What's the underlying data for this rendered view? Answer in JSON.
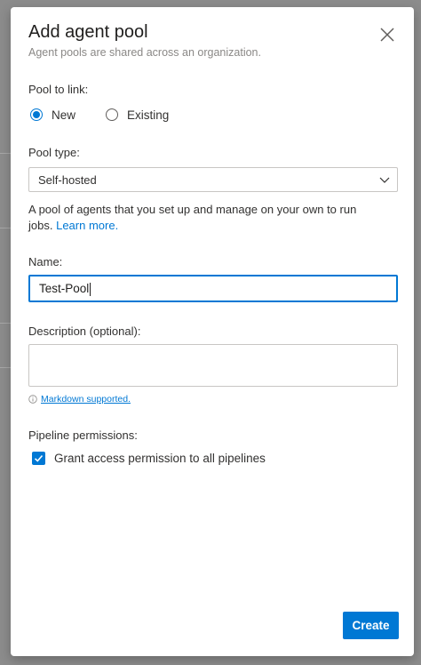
{
  "dialog": {
    "title": "Add agent pool",
    "subtitle": "Agent pools are shared across an organization.",
    "close_icon": "close-icon"
  },
  "pool_to_link": {
    "label": "Pool to link:",
    "options": [
      {
        "label": "New",
        "selected": true
      },
      {
        "label": "Existing",
        "selected": false
      }
    ]
  },
  "pool_type": {
    "label": "Pool type:",
    "value": "Self-hosted",
    "help_text": "A pool of agents that you set up and manage on your own to run jobs.",
    "learn_more": "Learn more."
  },
  "name": {
    "label": "Name:",
    "value": "Test-Pool"
  },
  "description": {
    "label": "Description (optional):",
    "value": "",
    "markdown_hint": "Markdown supported."
  },
  "pipeline_permissions": {
    "label": "Pipeline permissions:",
    "checkbox_label": "Grant access permission to all pipelines",
    "checked": true
  },
  "footer": {
    "create_label": "Create"
  },
  "colors": {
    "accent": "#0078d4",
    "text": "#323130",
    "subtle": "#8a8886"
  }
}
